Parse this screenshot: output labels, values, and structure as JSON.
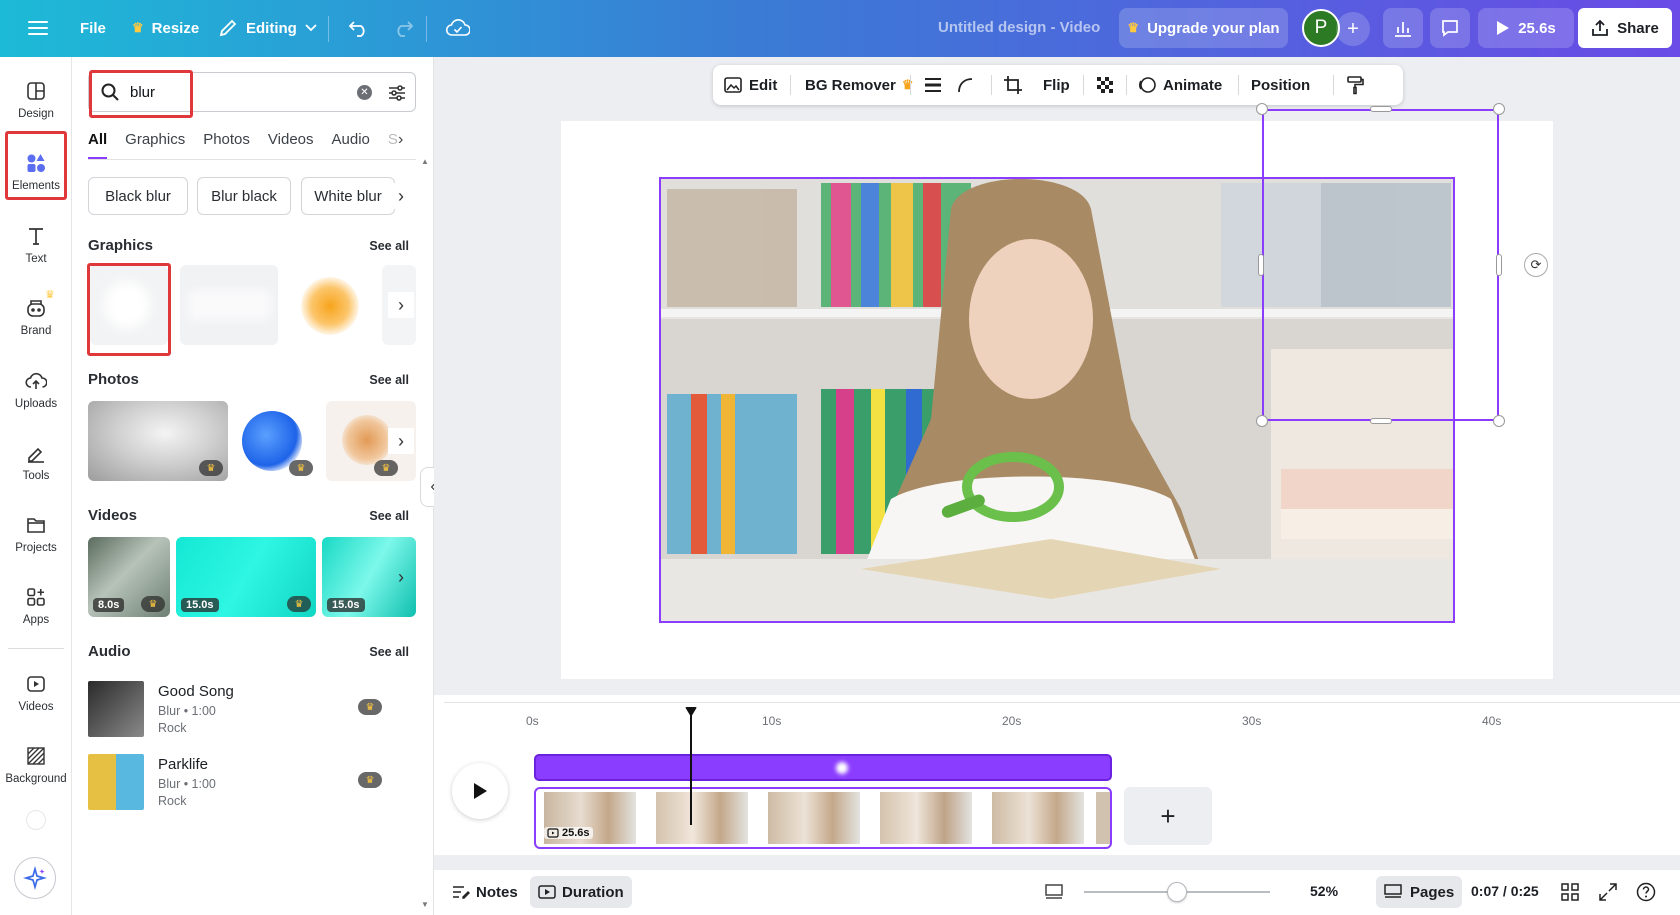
{
  "header": {
    "file_label": "File",
    "resize_label": "Resize",
    "editing_label": "Editing",
    "doc_title": "Untitled design - Video",
    "upgrade_label": "Upgrade your plan",
    "avatar_initial": "P",
    "play_duration": "25.6s",
    "share_label": "Share"
  },
  "rail": {
    "items": [
      {
        "label": "Design"
      },
      {
        "label": "Elements"
      },
      {
        "label": "Text"
      },
      {
        "label": "Brand"
      },
      {
        "label": "Uploads"
      },
      {
        "label": "Tools"
      },
      {
        "label": "Projects"
      },
      {
        "label": "Apps"
      },
      {
        "label": "Videos"
      },
      {
        "label": "Background"
      }
    ]
  },
  "panel": {
    "search_value": "blur",
    "tabs": [
      "All",
      "Graphics",
      "Photos",
      "Videos",
      "Audio",
      "S"
    ],
    "active_tab": "All",
    "chips": [
      "Black blur",
      "Blur black",
      "White blur"
    ],
    "sections": {
      "graphics": "Graphics",
      "photos": "Photos",
      "videos": "Videos",
      "audio": "Audio",
      "see_all": "See all"
    },
    "video_durations": [
      "8.0s",
      "15.0s",
      "15.0s"
    ],
    "audio_items": [
      {
        "title": "Good Song",
        "meta": "Blur • 1:00",
        "genre": "Rock"
      },
      {
        "title": "Parklife",
        "meta": "Blur • 1:00",
        "genre": "Rock"
      }
    ]
  },
  "toolbar": {
    "edit": "Edit",
    "bg_remover": "BG Remover",
    "flip": "Flip",
    "animate": "Animate",
    "position": "Position"
  },
  "timeline": {
    "ticks": [
      "0s",
      "10s",
      "20s",
      "30s",
      "40s"
    ],
    "clip_duration": "25.6s",
    "playhead_fraction": 0.27
  },
  "bottom": {
    "notes": "Notes",
    "duration": "Duration",
    "zoom": "52%",
    "pages": "Pages",
    "time": "0:07 / 0:25"
  },
  "colors": {
    "accent": "#8b3dff",
    "highlight": "#e0373b",
    "crown": "#ffc940"
  }
}
